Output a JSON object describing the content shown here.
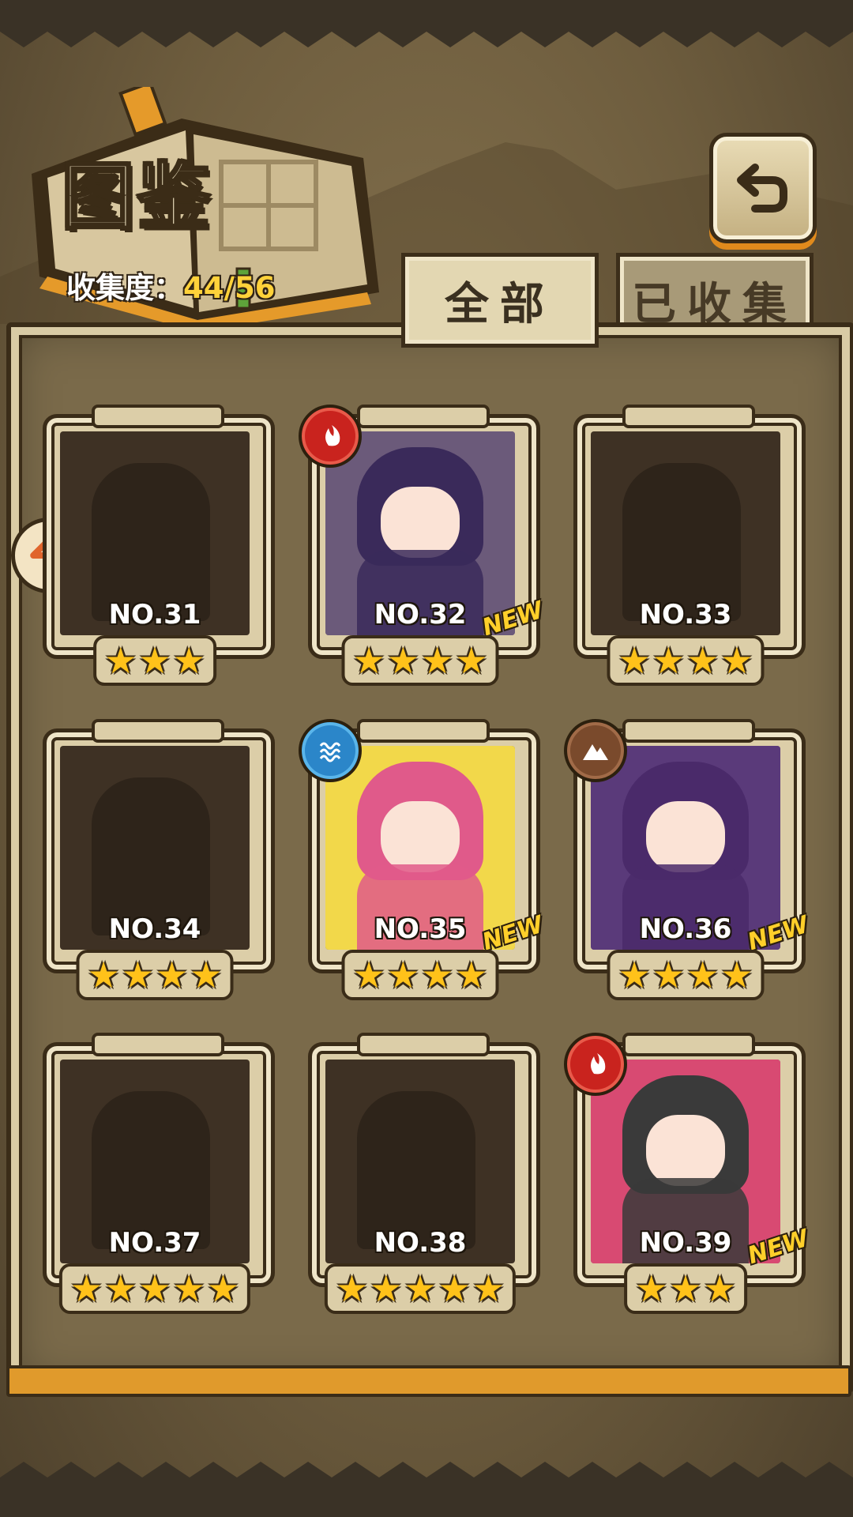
{
  "header": {
    "title": "图鉴",
    "collection_label": "收集度：",
    "collection_value": "44/56"
  },
  "tabs": [
    {
      "label": "全部",
      "active": true
    },
    {
      "label": "已收集",
      "active": false
    }
  ],
  "cards": [
    {
      "number": "NO.31",
      "stars": 3,
      "unlocked": false,
      "new": false,
      "element": null
    },
    {
      "number": "NO.32",
      "stars": 4,
      "unlocked": true,
      "new": true,
      "element": "fire"
    },
    {
      "number": "NO.33",
      "stars": 4,
      "unlocked": false,
      "new": false,
      "element": null
    },
    {
      "number": "NO.34",
      "stars": 4,
      "unlocked": false,
      "new": false,
      "element": null
    },
    {
      "number": "NO.35",
      "stars": 4,
      "unlocked": true,
      "new": true,
      "element": "water"
    },
    {
      "number": "NO.36",
      "stars": 4,
      "unlocked": true,
      "new": true,
      "element": "earth"
    },
    {
      "number": "NO.37",
      "stars": 5,
      "unlocked": false,
      "new": false,
      "element": null
    },
    {
      "number": "NO.38",
      "stars": 5,
      "unlocked": false,
      "new": false,
      "element": null
    },
    {
      "number": "NO.39",
      "stars": 3,
      "unlocked": true,
      "new": true,
      "element": "fire"
    }
  ],
  "new_label": "NEW",
  "colors": {
    "accent_orange": "#e09a2c",
    "star_gold": "#ffc21a",
    "collection_value": "#ffd23a",
    "fire": "#c9231e",
    "water": "#2b86c9",
    "earth": "#7a4a2c"
  }
}
